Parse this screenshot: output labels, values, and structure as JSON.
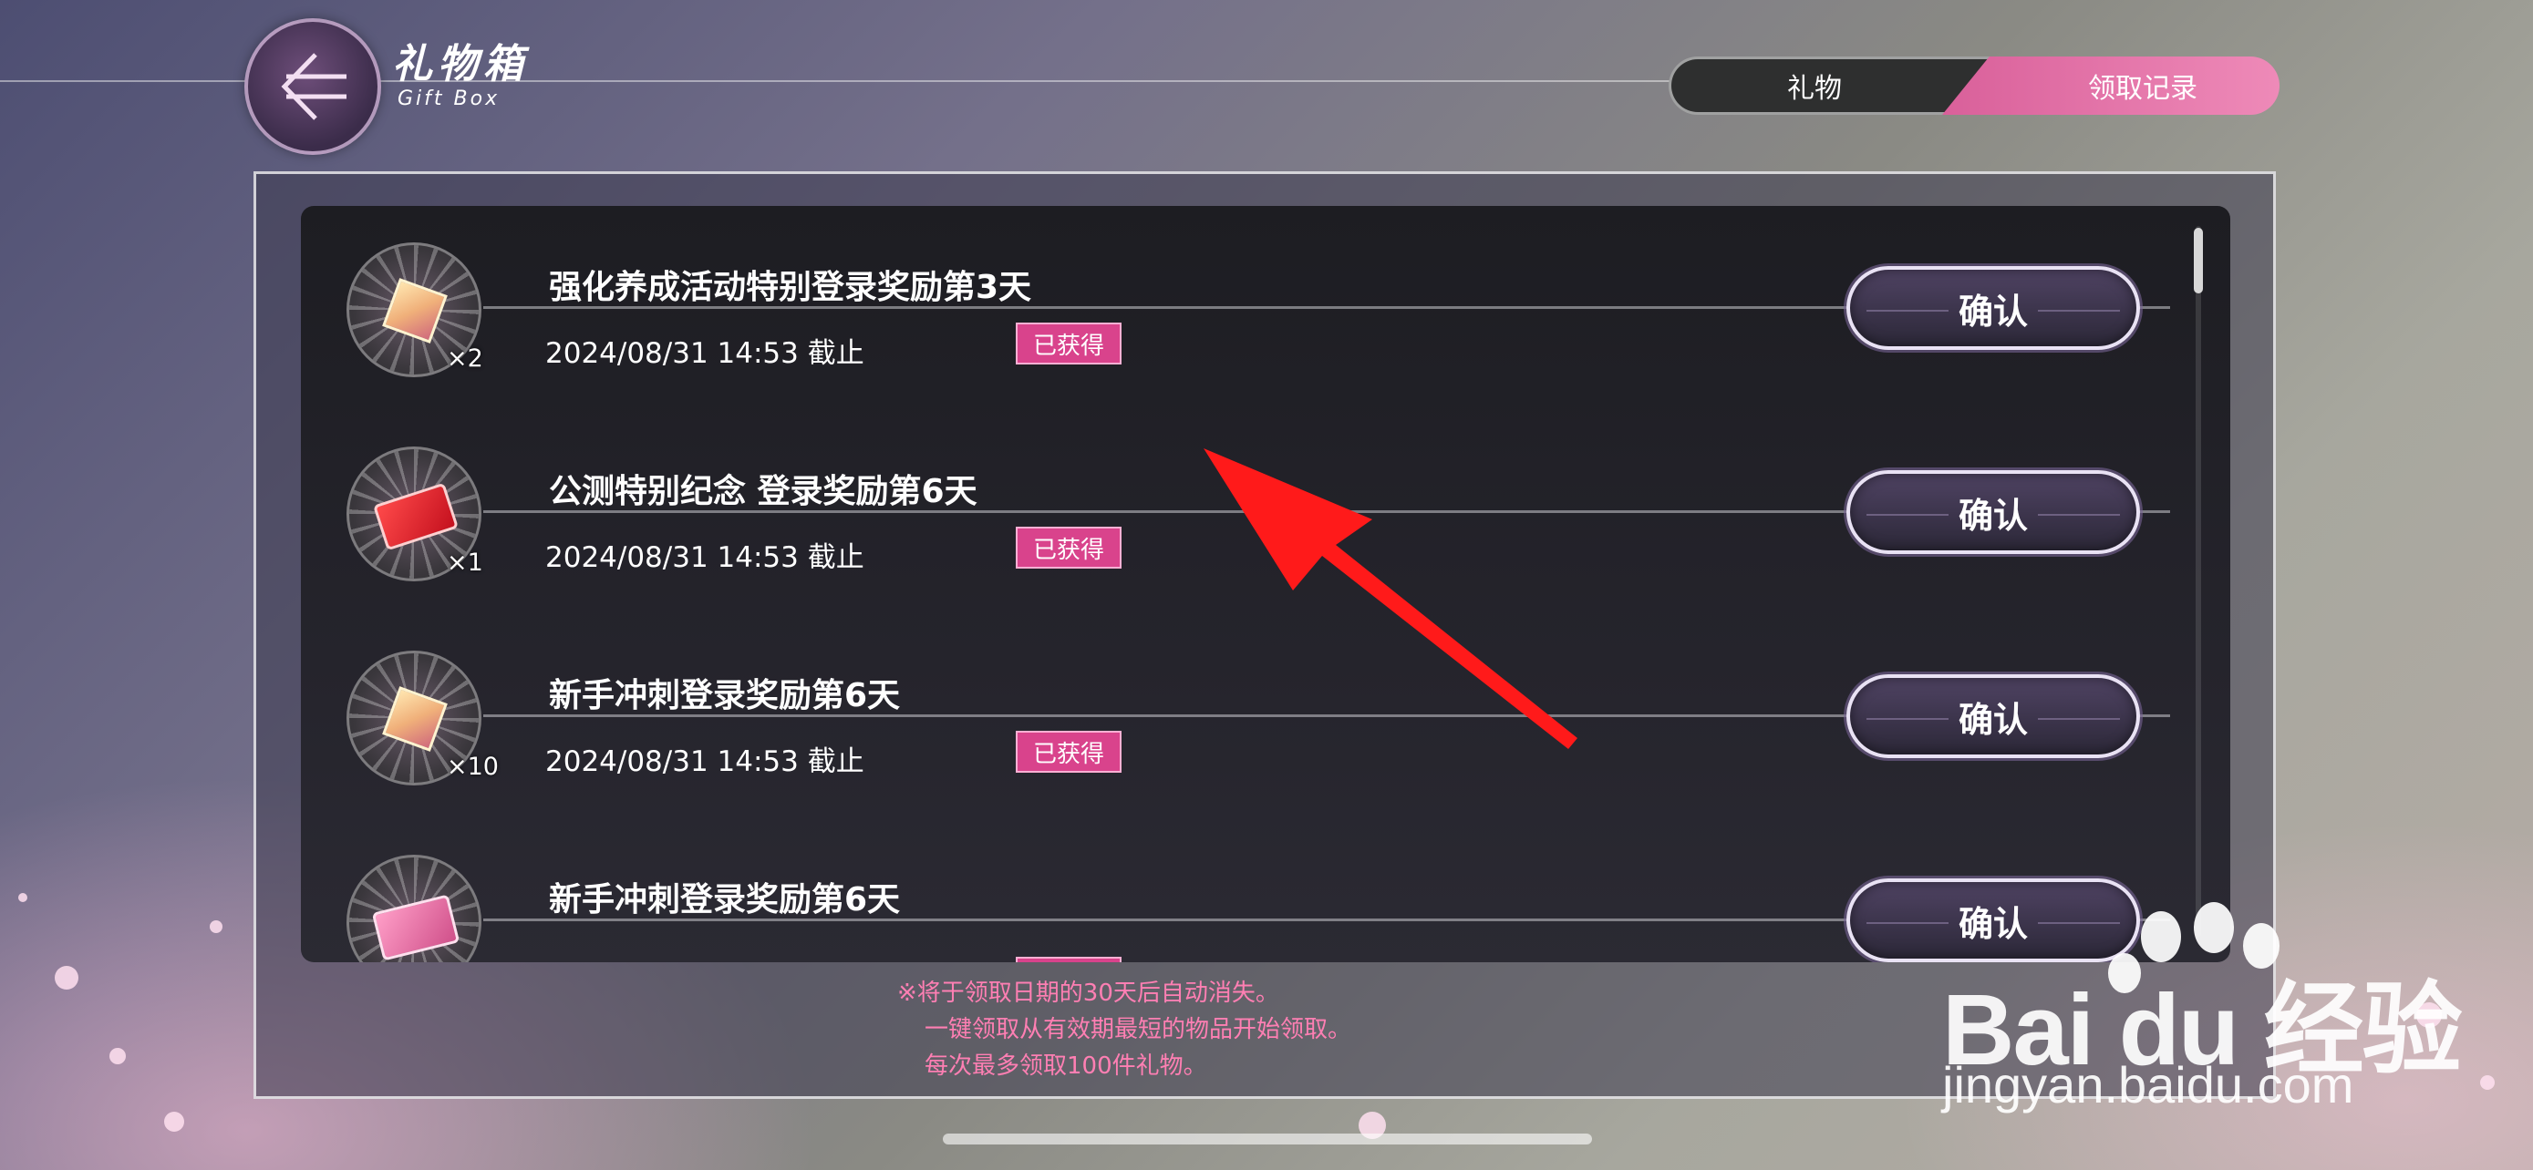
{
  "header": {
    "title": "礼物箱",
    "subtitle": "Gift Box",
    "back_icon": "back-arrow-icon"
  },
  "tabs": [
    {
      "label": "礼物",
      "active": false
    },
    {
      "label": "领取记录",
      "active": true
    }
  ],
  "gifts": [
    {
      "title": "强化养成活动特别登录奖励第3天",
      "date": "2024/08/31  14:53  截止",
      "qty": "×2",
      "status": "已获得",
      "action": "确认",
      "icon": "crystal-icon"
    },
    {
      "title": "公测特别纪念 登录奖励第6天",
      "date": "2024/08/31  14:53  截止",
      "qty": "×1",
      "status": "已获得",
      "action": "确认",
      "icon": "red-ticket-icon"
    },
    {
      "title": "新手冲刺登录奖励第6天",
      "date": "2024/08/31  14:53  截止",
      "qty": "×10",
      "status": "已获得",
      "action": "确认",
      "icon": "crystal-icon"
    },
    {
      "title": "新手冲刺登录奖励第6天",
      "action": "确认",
      "icon": "pink-ticket-icon"
    }
  ],
  "notes": [
    "※将于领取日期的30天后自动消失。",
    "一键领取从有效期最短的物品开始领取。",
    "每次最多领取100件礼物。"
  ],
  "watermark": {
    "logo": "Bai du 经验",
    "url": "jingyan.baidu.com"
  },
  "colors": {
    "accent_pink": "#d9438c",
    "active_tab": "#ee8ab8",
    "note_text": "#ff7fb3",
    "annotation_arrow": "#ff1a1a"
  }
}
